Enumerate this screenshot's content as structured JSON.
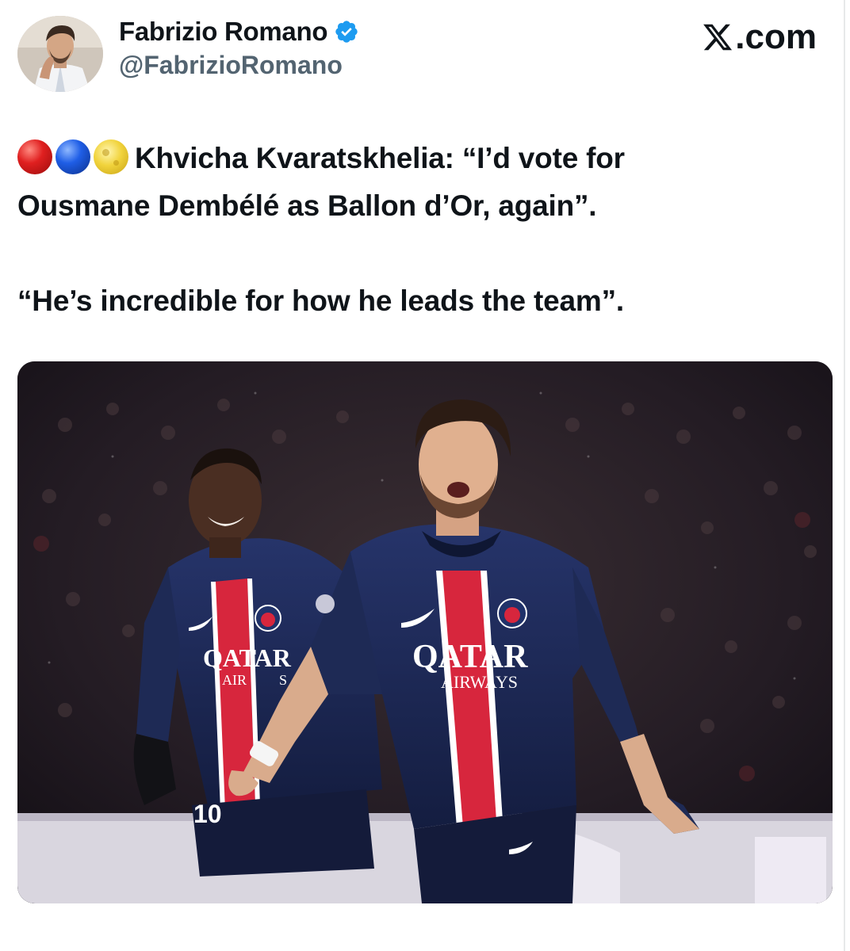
{
  "header": {
    "display_name": "Fabrizio Romano",
    "handle": "@FabrizioRomano",
    "brand_text": ".com",
    "verified": true
  },
  "tweet": {
    "emojis": [
      "red-circle",
      "blue-circle",
      "full-moon"
    ],
    "line1": "Khvicha Kvaratskhelia: “I’d vote for",
    "line2": "Ousmane Dembélé as Ballon d’Or, again”.",
    "line3": "“He’s incredible for how he leads the team”."
  },
  "photo": {
    "sponsor_main": "QATAR",
    "sponsor_sub": "AIRWAYS",
    "sponsor_left_main": "QATAR",
    "sponsor_left_sub": "AIR",
    "sponsor_left_tail": "S",
    "jersey_number": "10"
  },
  "colors": {
    "text_primary": "#0f1419",
    "text_secondary": "#536471",
    "verified_blue": "#1d9bf0",
    "psg_navy": "#1c2a55",
    "psg_red": "#d7263d"
  }
}
